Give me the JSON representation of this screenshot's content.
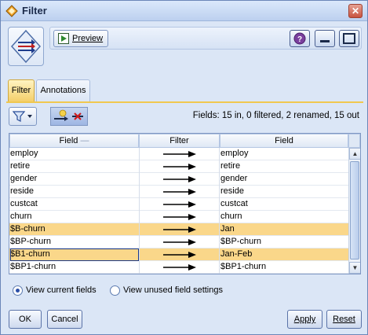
{
  "window": {
    "title": "Filter",
    "close_label": "✕"
  },
  "toolbar": {
    "preview_label": "Preview"
  },
  "tabs": [
    {
      "label": "Filter"
    },
    {
      "label": "Annotations"
    }
  ],
  "summary": {
    "text": "Fields: 15 in, 0 filtered, 2 renamed, 15 out"
  },
  "table": {
    "headers": [
      "Field",
      "Filter",
      "Field"
    ],
    "sort_indicator": "—",
    "rows": [
      {
        "field": "employ",
        "output": "employ"
      },
      {
        "field": "retire",
        "output": "retire"
      },
      {
        "field": "gender",
        "output": "gender"
      },
      {
        "field": "reside",
        "output": "reside"
      },
      {
        "field": "custcat",
        "output": "custcat"
      },
      {
        "field": "churn",
        "output": "churn"
      },
      {
        "field": "$B-churn",
        "output": "Jan"
      },
      {
        "field": "$BP-churn",
        "output": "$BP-churn"
      },
      {
        "field": "$B1-churn",
        "output": "Jan-Feb"
      },
      {
        "field": "$BP1-churn",
        "output": "$BP1-churn"
      }
    ],
    "highlighted_color": "#fad78a"
  },
  "view_options": {
    "current_label": "View current fields",
    "unused_label": "View unused field settings"
  },
  "buttons": {
    "ok": "OK",
    "cancel": "Cancel",
    "apply": "Apply",
    "reset": "Reset"
  },
  "icons": {
    "app": "filter-node-icon",
    "node": "filter-node-icon",
    "preview": "preview-icon",
    "help": "help-icon",
    "minimize": "minimize-icon",
    "maximize": "maximize-icon",
    "filter_menu": "filter-funnel-icon",
    "toggle": "toggle-filter-icon"
  }
}
